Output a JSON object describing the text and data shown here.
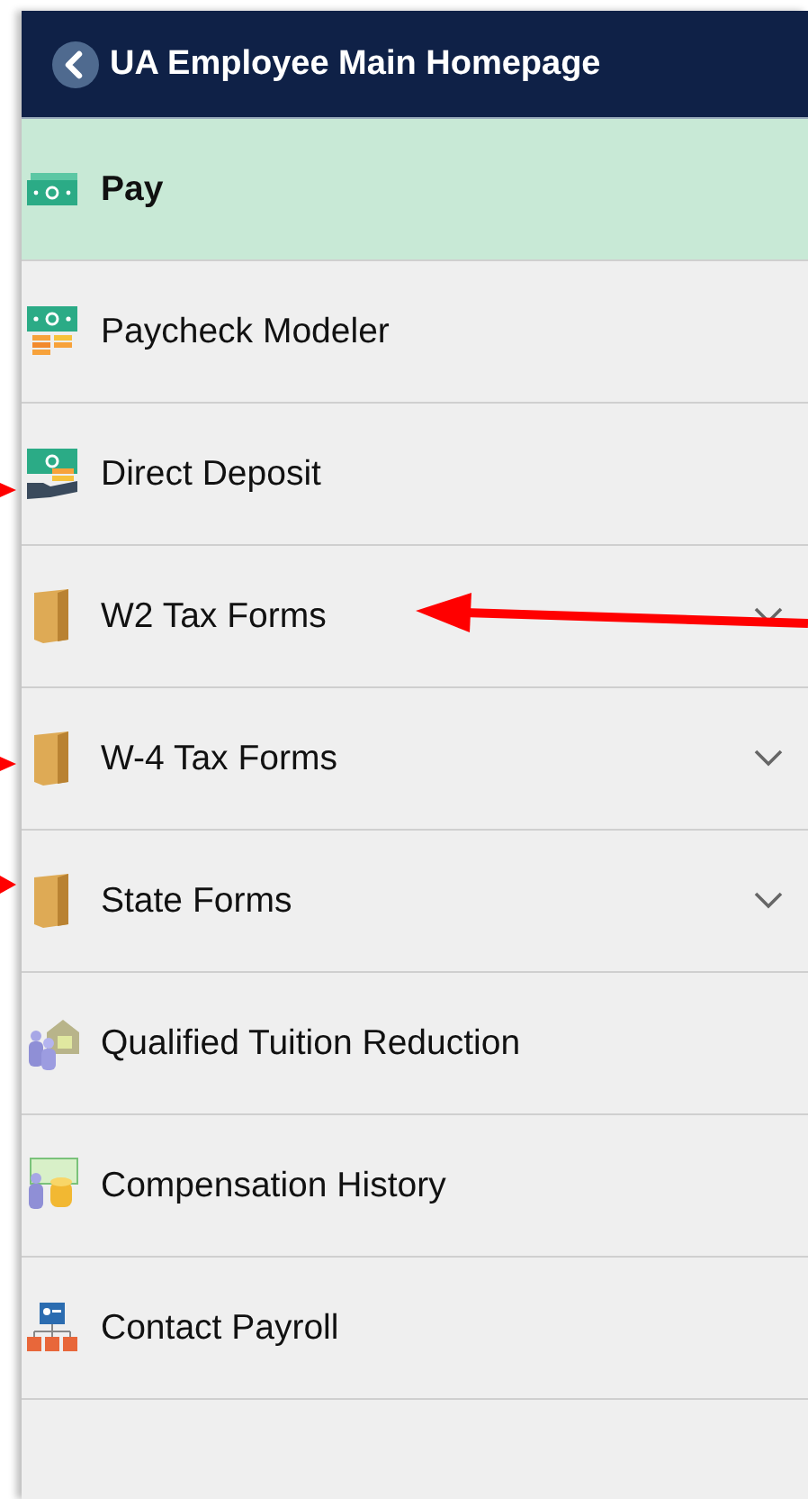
{
  "header": {
    "title": "UA Employee Main Homepage"
  },
  "items": [
    {
      "label": "Pay",
      "kind": "cash",
      "selected": true,
      "expandable": false
    },
    {
      "label": "Paycheck Modeler",
      "kind": "paycheck",
      "selected": false,
      "expandable": false
    },
    {
      "label": "Direct Deposit",
      "kind": "deposit",
      "selected": false,
      "expandable": false
    },
    {
      "label": "W2 Tax Forms",
      "kind": "folder",
      "selected": false,
      "expandable": true
    },
    {
      "label": "W-4 Tax Forms",
      "kind": "folder",
      "selected": false,
      "expandable": true
    },
    {
      "label": "State Forms",
      "kind": "folder",
      "selected": false,
      "expandable": true
    },
    {
      "label": "Qualified Tuition Reduction",
      "kind": "tuition",
      "selected": false,
      "expandable": false
    },
    {
      "label": "Compensation History",
      "kind": "compensation",
      "selected": false,
      "expandable": false
    },
    {
      "label": "Contact Payroll",
      "kind": "contact",
      "selected": false,
      "expandable": false
    }
  ]
}
